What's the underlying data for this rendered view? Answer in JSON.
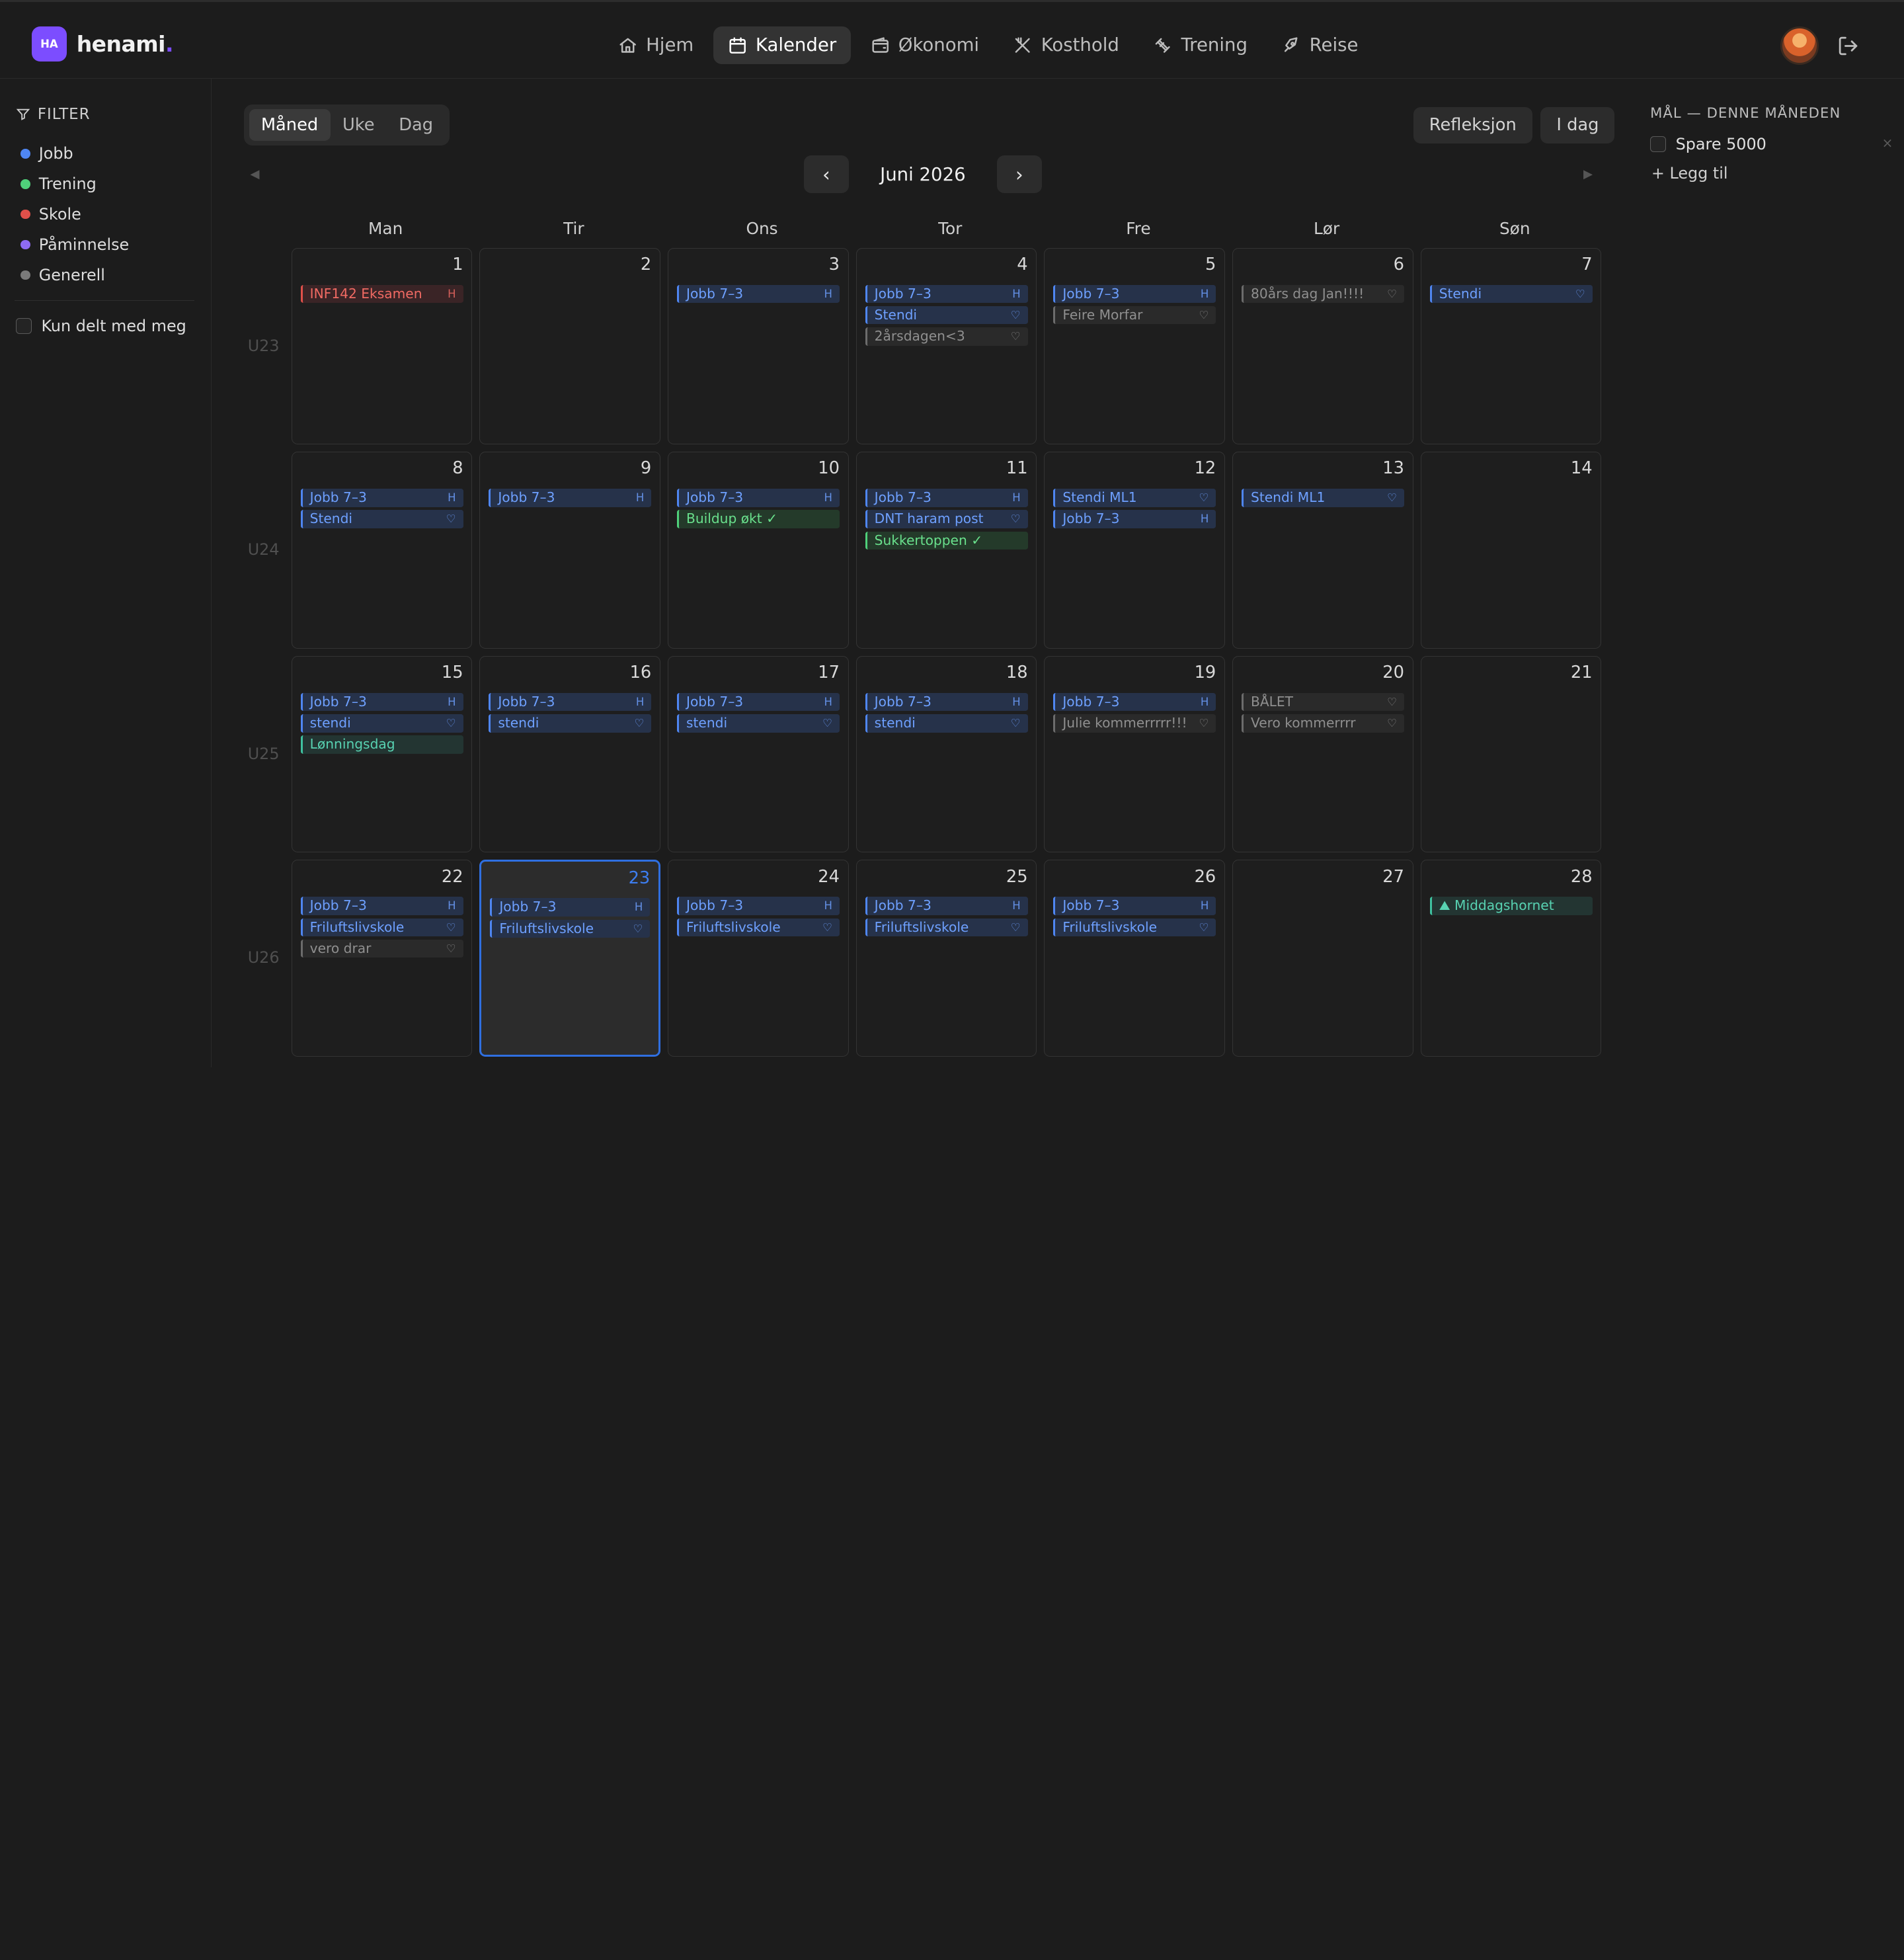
{
  "brand": {
    "badge": "HA",
    "name": "henami",
    "accent": "#7c4dff"
  },
  "nav": [
    {
      "label": "Hjem",
      "icon": "home-icon"
    },
    {
      "label": "Kalender",
      "icon": "calendar-icon",
      "active": true
    },
    {
      "label": "Økonomi",
      "icon": "wallet-icon"
    },
    {
      "label": "Kosthold",
      "icon": "utensils-icon"
    },
    {
      "label": "Trening",
      "icon": "dumbbell-icon"
    },
    {
      "label": "Reise",
      "icon": "rocket-icon"
    }
  ],
  "sidebar": {
    "filter_title": "FILTER",
    "filters": [
      {
        "label": "Jobb",
        "color": "#4f86f2"
      },
      {
        "label": "Trening",
        "color": "#4fd07a"
      },
      {
        "label": "Skole",
        "color": "#e0504a"
      },
      {
        "label": "Påminnelse",
        "color": "#8e6bf2"
      },
      {
        "label": "Generell",
        "color": "#7a7a7a"
      }
    ],
    "shared_label": "Kun delt med meg"
  },
  "toolbar": {
    "views": [
      "Måned",
      "Uke",
      "Dag"
    ],
    "active_view": "Måned",
    "reflection_label": "Refleksjon",
    "today_label": "I dag",
    "month_title": "Juni 2026",
    "prev": "‹",
    "next": "›",
    "mini_prev": "◀",
    "mini_next": "▶"
  },
  "weekdays": [
    "Man",
    "Tir",
    "Ons",
    "Tor",
    "Fre",
    "Lør",
    "Søn"
  ],
  "weeks": [
    {
      "label": "U23",
      "days": [
        {
          "num": "1",
          "events": [
            {
              "title": "INF142 Eksamen",
              "color": "red",
              "mark": "H"
            }
          ]
        },
        {
          "num": "2",
          "events": []
        },
        {
          "num": "3",
          "events": [
            {
              "title": "Jobb 7–3",
              "color": "blue",
              "mark": "H"
            }
          ]
        },
        {
          "num": "4",
          "events": [
            {
              "title": "Jobb 7–3",
              "color": "blue",
              "mark": "H"
            },
            {
              "title": "Stendi",
              "color": "blue",
              "mark": "♡"
            },
            {
              "title": "2årsdagen<3",
              "color": "gray",
              "mark": "♡"
            }
          ]
        },
        {
          "num": "5",
          "events": [
            {
              "title": "Jobb 7–3",
              "color": "blue",
              "mark": "H"
            },
            {
              "title": "Feire Morfar",
              "color": "gray",
              "mark": "♡"
            }
          ]
        },
        {
          "num": "6",
          "events": [
            {
              "title": "80års dag Jan!!!!",
              "color": "gray",
              "mark": "♡"
            }
          ]
        },
        {
          "num": "7",
          "events": [
            {
              "title": "Stendi",
              "color": "blue",
              "mark": "♡"
            }
          ]
        }
      ]
    },
    {
      "label": "U24",
      "days": [
        {
          "num": "8",
          "events": [
            {
              "title": "Jobb 7–3",
              "color": "blue",
              "mark": "H"
            },
            {
              "title": "Stendi",
              "color": "blue",
              "mark": "♡"
            }
          ]
        },
        {
          "num": "9",
          "events": [
            {
              "title": "Jobb 7–3",
              "color": "blue",
              "mark": "H"
            }
          ]
        },
        {
          "num": "10",
          "events": [
            {
              "title": "Jobb 7–3",
              "color": "blue",
              "mark": "H"
            },
            {
              "title": "Buildup økt ✓",
              "color": "green",
              "mark": ""
            }
          ]
        },
        {
          "num": "11",
          "events": [
            {
              "title": "Jobb 7–3",
              "color": "blue",
              "mark": "H"
            },
            {
              "title": "DNT haram post",
              "color": "blue",
              "mark": "♡"
            },
            {
              "title": "Sukkertoppen ✓",
              "color": "green",
              "mark": ""
            }
          ]
        },
        {
          "num": "12",
          "events": [
            {
              "title": "Stendi ML1",
              "color": "blue",
              "mark": "♡"
            },
            {
              "title": "Jobb 7–3",
              "color": "blue",
              "mark": "H"
            }
          ]
        },
        {
          "num": "13",
          "events": [
            {
              "title": "Stendi ML1",
              "color": "blue",
              "mark": "♡"
            }
          ]
        },
        {
          "num": "14",
          "events": []
        }
      ]
    },
    {
      "label": "U25",
      "days": [
        {
          "num": "15",
          "events": [
            {
              "title": "Jobb 7–3",
              "color": "blue",
              "mark": "H"
            },
            {
              "title": "stendi",
              "color": "blue",
              "mark": "♡"
            },
            {
              "title": "Lønningsdag",
              "color": "teal",
              "mark": ""
            }
          ]
        },
        {
          "num": "16",
          "events": [
            {
              "title": "Jobb 7–3",
              "color": "blue",
              "mark": "H"
            },
            {
              "title": "stendi",
              "color": "blue",
              "mark": "♡"
            }
          ]
        },
        {
          "num": "17",
          "events": [
            {
              "title": "Jobb 7–3",
              "color": "blue",
              "mark": "H"
            },
            {
              "title": "stendi",
              "color": "blue",
              "mark": "♡"
            }
          ]
        },
        {
          "num": "18",
          "events": [
            {
              "title": "Jobb 7–3",
              "color": "blue",
              "mark": "H"
            },
            {
              "title": "stendi",
              "color": "blue",
              "mark": "♡"
            }
          ]
        },
        {
          "num": "19",
          "events": [
            {
              "title": "Jobb 7–3",
              "color": "blue",
              "mark": "H"
            },
            {
              "title": "Julie kommerrrrr!!!",
              "color": "gray",
              "mark": "♡"
            }
          ]
        },
        {
          "num": "20",
          "events": [
            {
              "title": "BÅLET",
              "color": "gray",
              "mark": "♡"
            },
            {
              "title": "Vero kommerrrr",
              "color": "gray",
              "mark": "♡"
            }
          ]
        },
        {
          "num": "21",
          "events": []
        }
      ]
    },
    {
      "label": "U26",
      "days": [
        {
          "num": "22",
          "events": [
            {
              "title": "Jobb 7–3",
              "color": "blue",
              "mark": "H"
            },
            {
              "title": "Friluftslivskole",
              "color": "blue",
              "mark": "♡"
            },
            {
              "title": "vero drar",
              "color": "gray",
              "mark": "♡"
            }
          ]
        },
        {
          "num": "23",
          "today": true,
          "events": [
            {
              "title": "Jobb 7–3",
              "color": "blue",
              "mark": "H"
            },
            {
              "title": "Friluftslivskole",
              "color": "blue",
              "mark": "♡"
            }
          ]
        },
        {
          "num": "24",
          "events": [
            {
              "title": "Jobb 7–3",
              "color": "blue",
              "mark": "H"
            },
            {
              "title": "Friluftslivskole",
              "color": "blue",
              "mark": "♡"
            }
          ]
        },
        {
          "num": "25",
          "events": [
            {
              "title": "Jobb 7–3",
              "color": "blue",
              "mark": "H"
            },
            {
              "title": "Friluftslivskole",
              "color": "blue",
              "mark": "♡"
            }
          ]
        },
        {
          "num": "26",
          "events": [
            {
              "title": "Jobb 7–3",
              "color": "blue",
              "mark": "H"
            },
            {
              "title": "Friluftslivskole",
              "color": "blue",
              "mark": "♡"
            }
          ]
        },
        {
          "num": "27",
          "events": []
        },
        {
          "num": "28",
          "events": [
            {
              "title": "⛰ Middagshornet",
              "color": "teal",
              "mark": ""
            }
          ]
        }
      ]
    }
  ],
  "goals": {
    "title": "MÅL — DENNE MÅNEDEN",
    "items": [
      {
        "label": "Spare 5000",
        "remove": "×"
      }
    ],
    "add_label": "+ Legg til"
  }
}
